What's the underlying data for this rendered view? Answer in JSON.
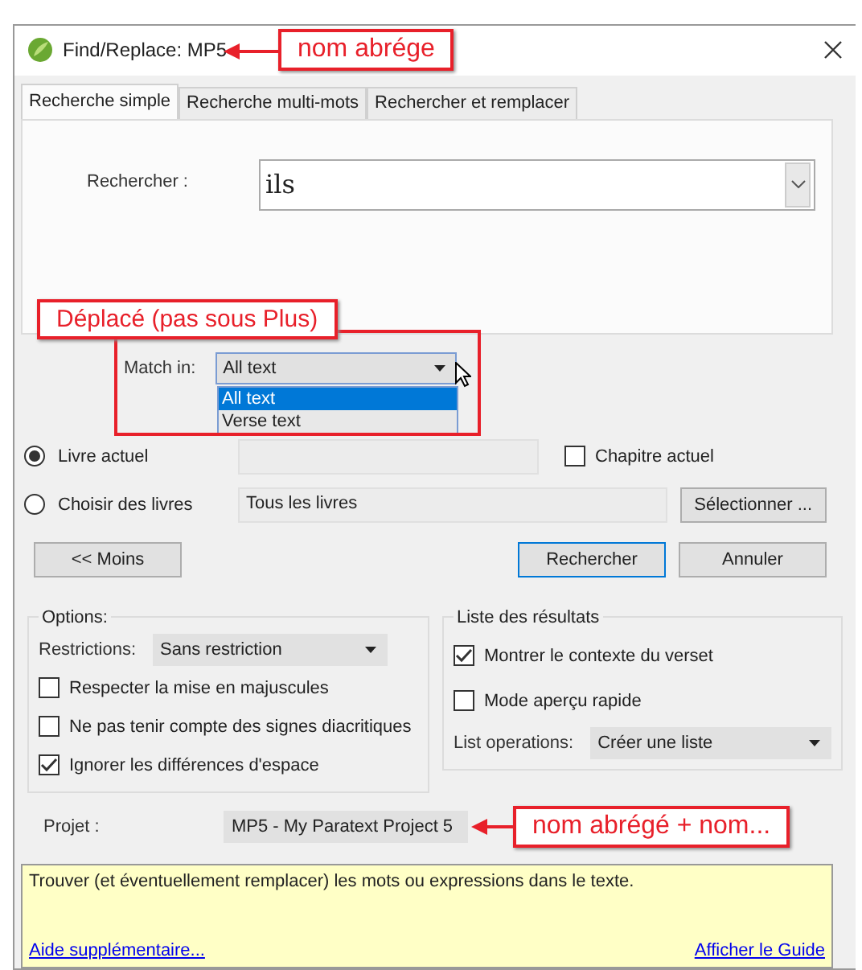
{
  "window": {
    "title": "Find/Replace: MP5"
  },
  "tabs": [
    {
      "label": "Recherche simple",
      "selected": true
    },
    {
      "label": "Recherche multi-mots",
      "selected": false
    },
    {
      "label": "Rechercher et remplacer",
      "selected": false
    }
  ],
  "search": {
    "label": "Rechercher :",
    "value": "ils"
  },
  "match_in": {
    "label": "Match in:",
    "value": "All text",
    "expanded": true,
    "options": [
      {
        "label": "All text",
        "selected": true
      },
      {
        "label": "Verse text",
        "selected": false
      }
    ]
  },
  "scope": [
    {
      "label": "Livre actuel",
      "selected": true
    },
    {
      "label": "Choisir des livres",
      "selected": false,
      "field": "Tous les livres"
    }
  ],
  "chapter": {
    "label": "Chapitre actuel",
    "checked": false
  },
  "select_button": "Sélectionner ...",
  "less_button": "<< Moins",
  "search_button": "Rechercher",
  "cancel_button": "Annuler",
  "options": {
    "title": "Options:",
    "restrictions_label": "Restrictions:",
    "restrictions_value": "Sans restriction",
    "checkboxes": [
      {
        "label": "Respecter la mise en majuscules",
        "checked": false
      },
      {
        "label": "Ne pas tenir compte des signes diacritiques",
        "checked": false
      },
      {
        "label": "Ignorer les différences d'espace",
        "checked": true
      }
    ]
  },
  "results": {
    "title": "Liste des résultats",
    "checkboxes": [
      {
        "label": "Montrer le contexte du verset",
        "checked": true
      },
      {
        "label": "Mode aperçu rapide",
        "checked": false
      }
    ],
    "operations_label": "List operations:",
    "operations_value": "Créer une liste"
  },
  "project": {
    "label": "Projet :",
    "value": "MP5 -  My Paratext Project 5"
  },
  "help": {
    "text": "Trouver (et éventuellement remplacer) les mots ou expressions dans le texte.",
    "links": [
      "Aide supplémentaire...",
      "Afficher le Guide"
    ]
  },
  "annotations": [
    {
      "text": "nom abrége"
    },
    {
      "text": "Déplacé (pas sous Plus)"
    },
    {
      "text": "nom abrégé + nom..."
    }
  ]
}
